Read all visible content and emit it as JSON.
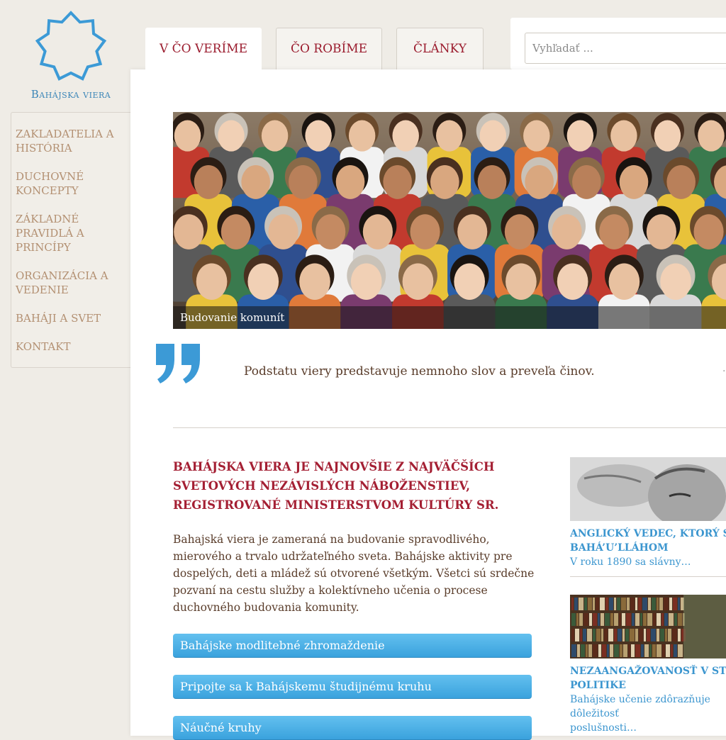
{
  "logo": {
    "text": "Bahájska viera",
    "color": "#3c9ad6"
  },
  "tabs": [
    {
      "label": "V ČO VERÍME",
      "active": true
    },
    {
      "label": "ČO ROBÍME",
      "active": false
    },
    {
      "label": "ČLÁNKY",
      "active": false
    }
  ],
  "search": {
    "placeholder": "Vyhľadať ..."
  },
  "sidebar": {
    "items": [
      {
        "label": "ZAKLADATELIA A HISTÓRIA"
      },
      {
        "label": "DUCHOVNÉ KONCEPTY"
      },
      {
        "label": "ZÁKLADNÉ PRAVIDLÁ A PRINCÍPY"
      },
      {
        "label": "ORGANIZÁCIA A VEDENIE"
      },
      {
        "label": "BAHÁJI A SVET"
      },
      {
        "label": "KONTAKT"
      }
    ]
  },
  "hero": {
    "caption": "Budovanie komunít"
  },
  "quote": {
    "mark": "”",
    "text": "Podstatu viery predstavuje nemnoho slov a preveľa činov."
  },
  "main": {
    "headline": "BAHÁJSKA VIERA JE NAJNOVŠIE Z NAJVÄČŠÍCH SVETOVÝCH NEZÁVISLÝCH NÁBOŽENSTIEV, REGISTROVANÉ MINISTERSTVOM KULTÚRY SR.",
    "body": "Bahajská viera je zameraná na budovanie spravodlivého, mierového a trvalo udržateľného sveta. Bahájske aktivity pre dospelých, deti a mládež sú otvorené všetkým. Všetci sú srdečne pozvaní na cestu služby a kolektívneho učenia o procese duchovného budovania komunity.",
    "buttons": [
      {
        "label": "Bahájske modlitebné zhromaždenie"
      },
      {
        "label": "Pripojte sa k Bahájskemu študijnému kruhu"
      },
      {
        "label": "Náučné kruhy"
      }
    ]
  },
  "articles": [
    {
      "title": "ANGLICKÝ VEDEC, KTORÝ SA STRETOL S",
      "title2": "BAHÁ’U’LLÁHOM",
      "excerpt": "V roku 1890 sa slávny…"
    },
    {
      "title": "NEZAANGAŽOVANOSŤ V STRANÍCKEJ",
      "title2": "POLITIKE",
      "excerpt": "Bahájske učenie zdôrazňuje dôležitosť\nposlušnosti…"
    }
  ]
}
